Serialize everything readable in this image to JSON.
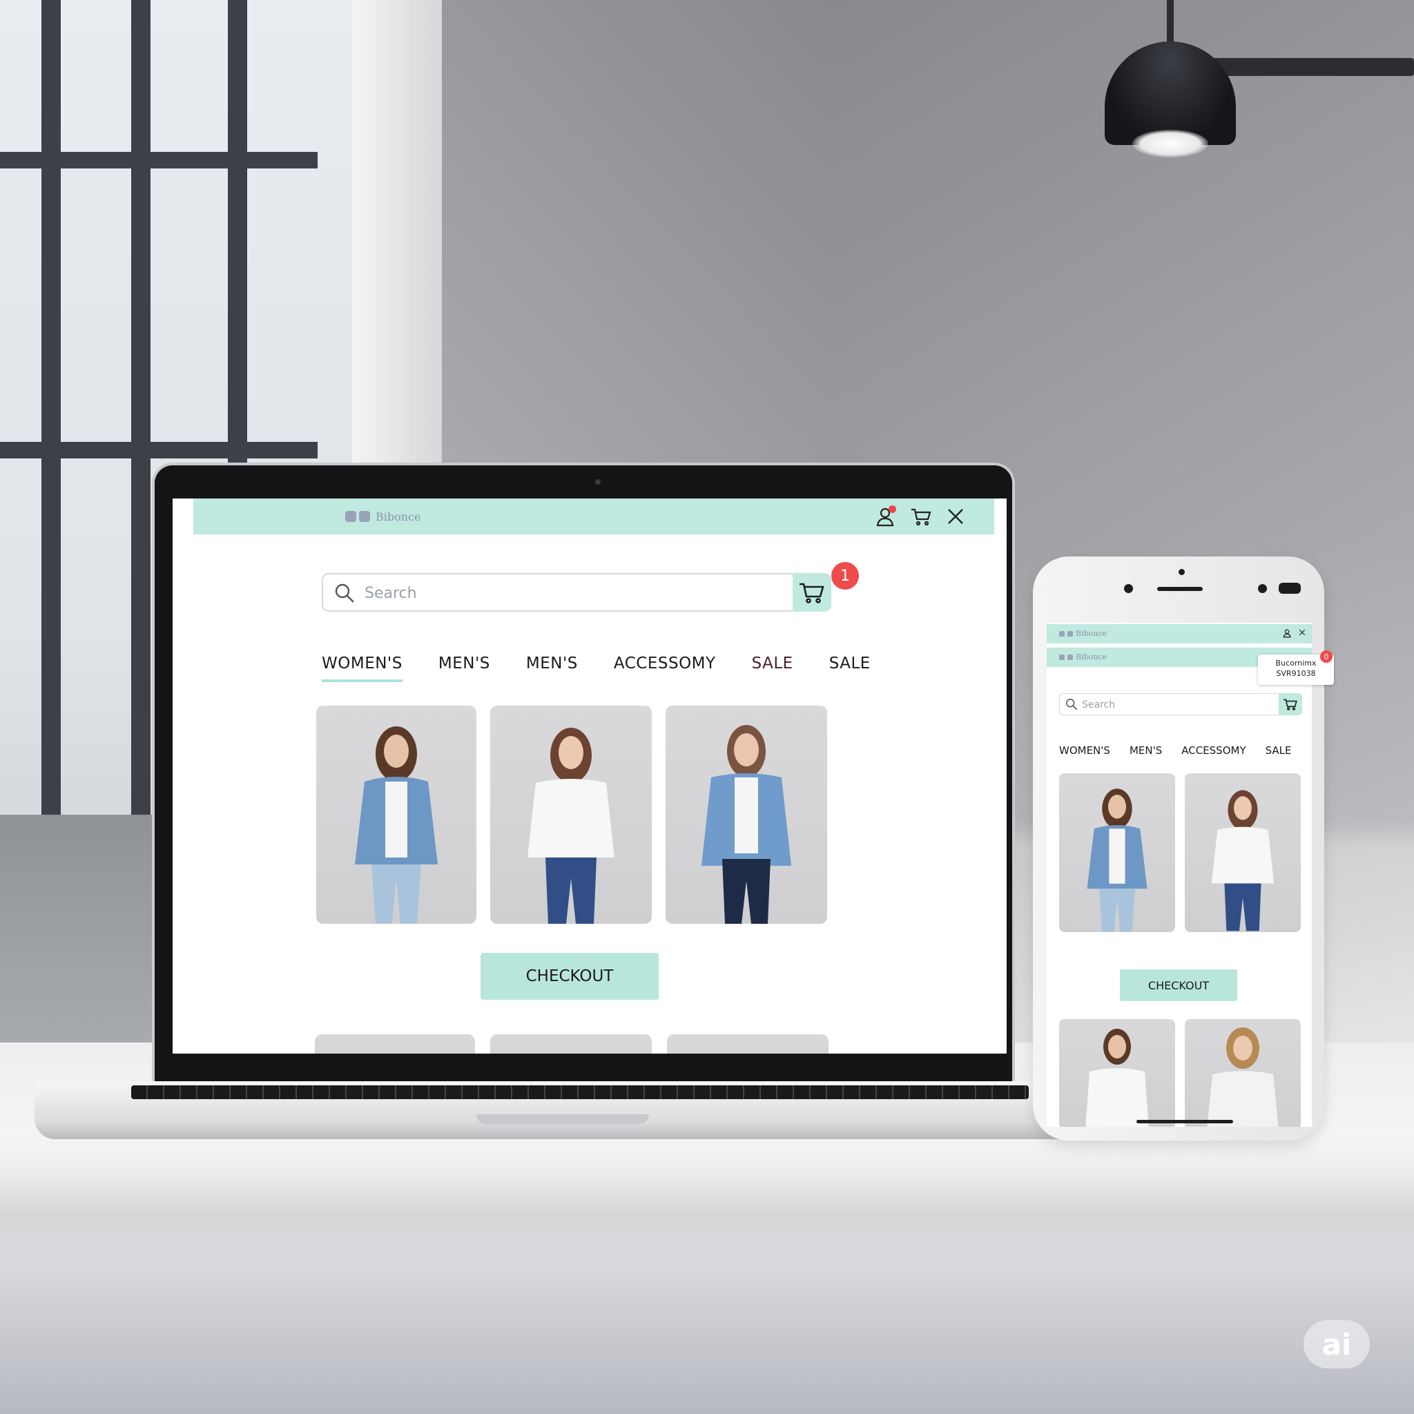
{
  "desktop": {
    "brand": {
      "text": "Bibonce"
    },
    "search": {
      "placeholder": "Search"
    },
    "cart_badge": "1",
    "nav": [
      {
        "label": "WOMEN'S",
        "active": true
      },
      {
        "label": "MEN'S",
        "active": false
      },
      {
        "label": "MEN'S",
        "active": false
      },
      {
        "label": "ACCESSOMY",
        "active": false
      },
      {
        "label": "SALE",
        "active": false
      },
      {
        "label": "SALE",
        "active": false
      }
    ],
    "products": [
      {
        "outfit": "denim-jacket-white-tee-light-jeans"
      },
      {
        "outfit": "white-blouse-dark-jeans"
      },
      {
        "outfit": "denim-jacket-white-tee-dark-jeans"
      }
    ],
    "checkout_label": "CHECKOUT"
  },
  "mobile": {
    "brand": {
      "text": "Bibonce"
    },
    "tooltip": {
      "line1": "Bucornimx",
      "line2": "SVR91038"
    },
    "tooltip_badge": "0",
    "search": {
      "placeholder": "Search"
    },
    "nav": [
      {
        "label": "WOMEN'S"
      },
      {
        "label": "MEN'S"
      },
      {
        "label": "ACCESSOMY"
      },
      {
        "label": "SALE"
      }
    ],
    "checkout_label": "CHECKOUT"
  },
  "watermark": "ai",
  "colors": {
    "accent_mint": "#c0e9df",
    "button_mint": "#b9e6db",
    "badge_red": "#ef4b4b",
    "text_dark": "#1b1b1b"
  },
  "icons": [
    "search-icon",
    "cart-icon",
    "user-icon",
    "close-icon"
  ]
}
